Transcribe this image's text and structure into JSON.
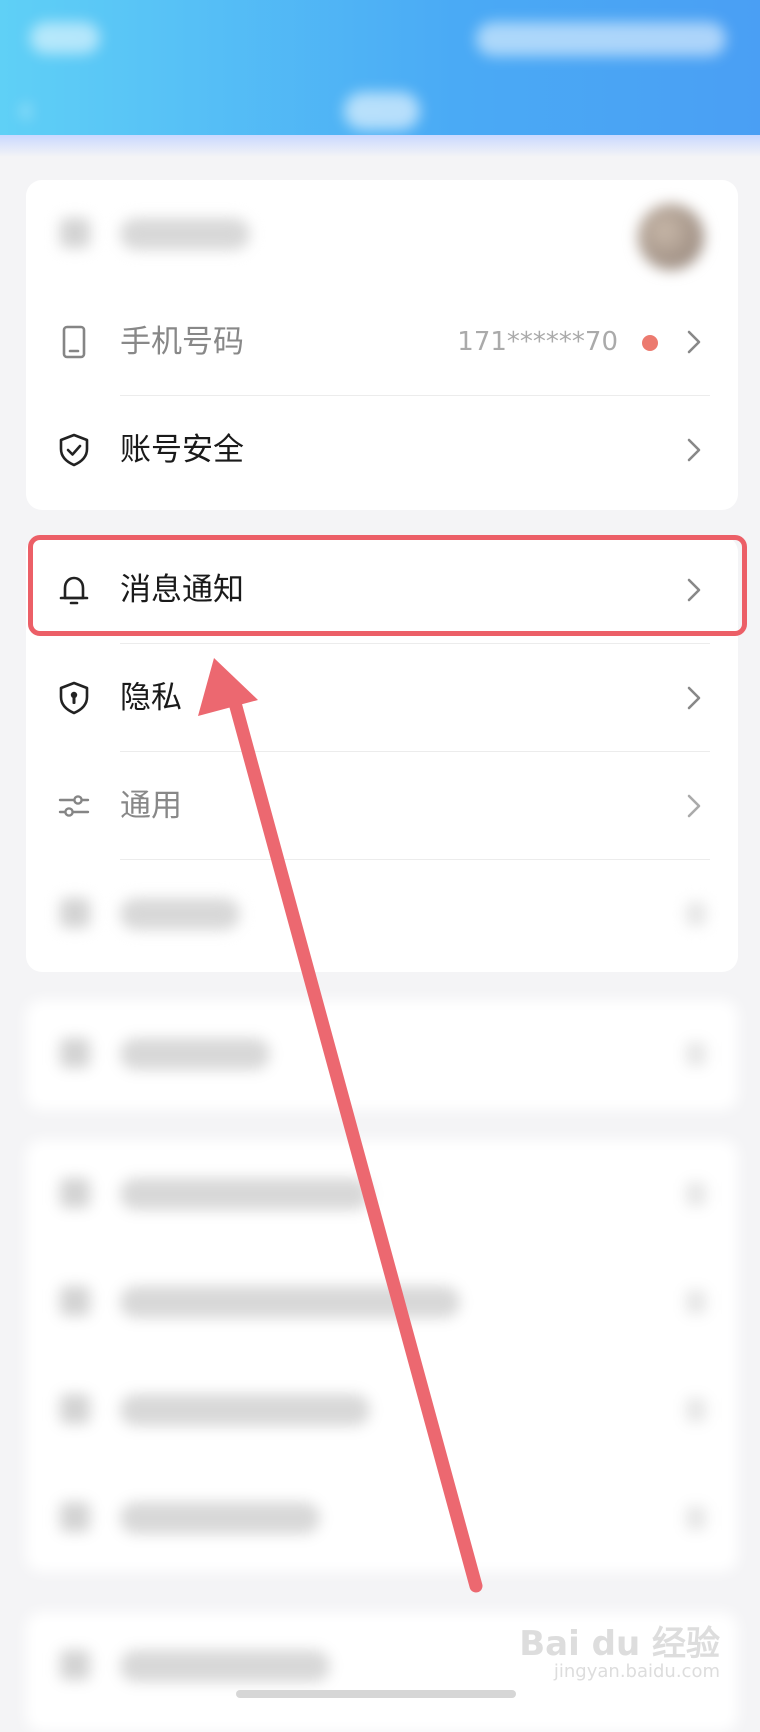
{
  "statusbar": {
    "time": "",
    "right": ""
  },
  "header": {
    "title": ""
  },
  "account_card": {
    "phone_label": "手机号码",
    "phone_value": "171******70",
    "security_label": "账号安全"
  },
  "settings_card": {
    "notifications_label": "消息通知",
    "privacy_label": "隐私",
    "general_label": "通用"
  },
  "watermark": {
    "main": "Bai du 经验",
    "sub": "jingyan.baidu.com"
  },
  "colors": {
    "header_gradient_start": "#5fd0f6",
    "header_gradient_end": "#4a9ff4",
    "highlight": "#ec5f67",
    "badge_dot": "#ec7a6f"
  },
  "icons": {
    "back": "chevron-left-icon",
    "profile": "user-icon",
    "phone": "phone-icon",
    "security": "shield-check-icon",
    "notifications": "bell-icon",
    "privacy": "shield-lock-icon",
    "general": "sliders-icon",
    "chevron": "chevron-right-icon"
  }
}
